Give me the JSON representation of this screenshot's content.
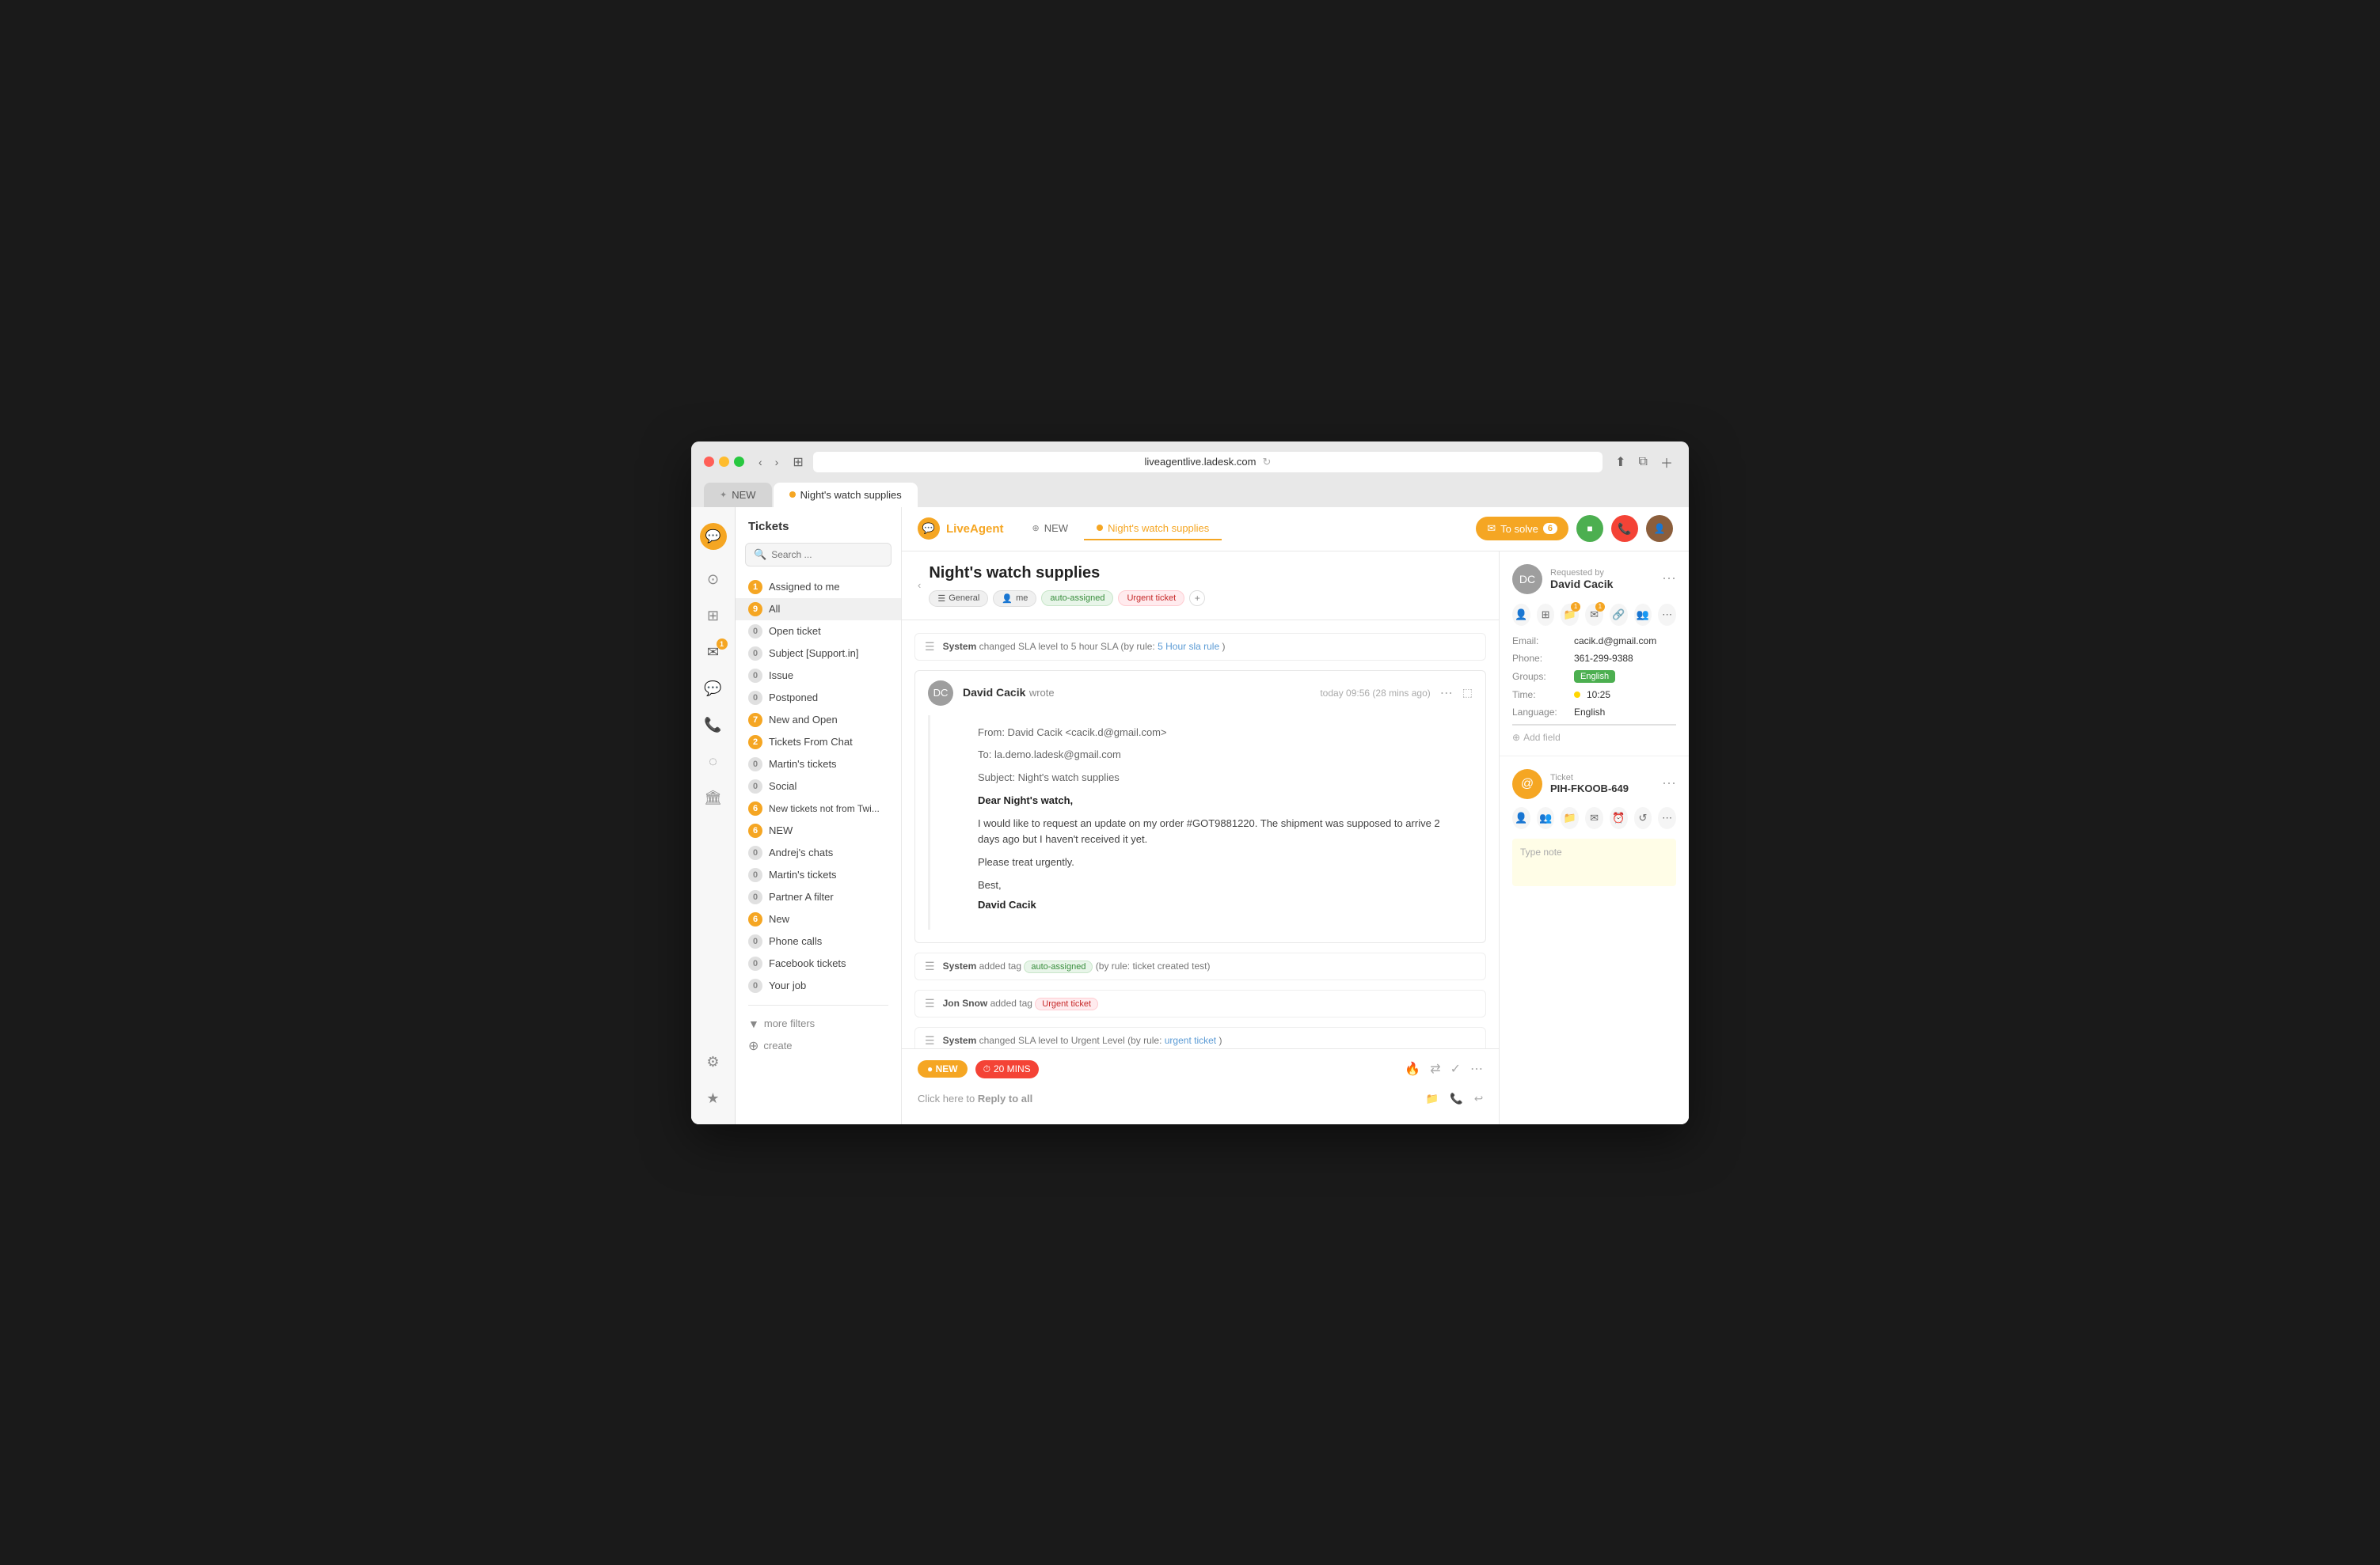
{
  "browser": {
    "url": "liveagentlive.ladesk.com",
    "tabs": [
      {
        "label": "NEW",
        "icon": "✦",
        "active": false
      },
      {
        "label": "Night's watch supplies",
        "dot": true,
        "active": true
      }
    ]
  },
  "header": {
    "logo_text": "LiveAgent",
    "solve_label": "To solve",
    "solve_count": "6",
    "tab_new": "NEW",
    "tab_ticket": "Night's watch supplies"
  },
  "sidebar": {
    "title": "Tickets",
    "search_placeholder": "Search ...",
    "items": [
      {
        "label": "Assigned to me",
        "count": "1",
        "count_type": "orange"
      },
      {
        "label": "All",
        "count": "9",
        "count_type": "orange",
        "active": true
      },
      {
        "label": "Open ticket",
        "count": "0",
        "count_type": "gray"
      },
      {
        "label": "Subject [Support.in]",
        "count": "0",
        "count_type": "gray"
      },
      {
        "label": "Issue",
        "count": "0",
        "count_type": "gray"
      },
      {
        "label": "Postponed",
        "count": "0",
        "count_type": "gray"
      },
      {
        "label": "New and Open",
        "count": "7",
        "count_type": "orange"
      },
      {
        "label": "Tickets From Chat",
        "count": "2",
        "count_type": "orange"
      },
      {
        "label": "Martin's tickets",
        "count": "0",
        "count_type": "gray"
      },
      {
        "label": "Social",
        "count": "0",
        "count_type": "gray"
      },
      {
        "label": "New tickets not from Twi...",
        "count": "6",
        "count_type": "orange"
      },
      {
        "label": "NEW",
        "count": "6",
        "count_type": "orange"
      },
      {
        "label": "Andrej's chats",
        "count": "0",
        "count_type": "gray"
      },
      {
        "label": "Martin's tickets",
        "count": "0",
        "count_type": "gray"
      },
      {
        "label": "Partner A filter",
        "count": "0",
        "count_type": "gray"
      },
      {
        "label": "New",
        "count": "6",
        "count_type": "orange"
      },
      {
        "label": "Phone calls",
        "count": "0",
        "count_type": "gray"
      },
      {
        "label": "Facebook tickets",
        "count": "0",
        "count_type": "gray"
      },
      {
        "label": "Your job",
        "count": "0",
        "count_type": "gray"
      }
    ],
    "more_filters": "more filters",
    "create": "create"
  },
  "ticket": {
    "title": "Night's watch supplies",
    "tags": [
      {
        "label": "General",
        "type": "general",
        "icon": "☰"
      },
      {
        "label": "me",
        "type": "me",
        "icon": "👤"
      },
      {
        "label": "auto-assigned",
        "type": "auto"
      },
      {
        "label": "Urgent ticket",
        "type": "urgent"
      }
    ],
    "system_msg_1": {
      "actor": "System",
      "action": "changed SLA level to 5 hour SLA (by rule:",
      "rule": "5 Hour sla rule",
      "suffix": ")"
    },
    "email": {
      "sender": "David Cacik",
      "wrote": "wrote",
      "time": "today 09:56 (28 mins ago)",
      "from": "From: David Cacik <cacik.d@gmail.com>",
      "to": "To: la.demo.ladesk@gmail.com",
      "subject": "Subject: Night's watch supplies",
      "greeting": "Dear Night's watch,",
      "body1": "I would like to request an update on my order #GOT9881220. The shipment was supposed to arrive 2 days ago but I haven't received it yet.",
      "body2": "Please treat urgently.",
      "closing": "Best,",
      "name": "David Cacik"
    },
    "system_msg_2": {
      "actor": "System",
      "action": "added tag",
      "tag": "auto-assigned",
      "rule": "(by rule: ticket created test)"
    },
    "system_msg_3": {
      "actor": "Jon Snow",
      "action": "added tag",
      "tag": "Urgent ticket"
    },
    "system_msg_4": {
      "actor": "System",
      "action": "changed SLA level to Urgent Level (by rule:",
      "rule": "urgent ticket",
      "suffix": ")"
    },
    "reply": {
      "status": "NEW",
      "timer": "20 MINS",
      "click_text": "Click here to",
      "reply_label": "Reply to all"
    }
  },
  "right_panel": {
    "requested_by": "Requested by",
    "requester_name": "David Cacik",
    "email_label": "Email:",
    "email_value": "cacik.d@gmail.com",
    "phone_label": "Phone:",
    "phone_value": "361-299-9388",
    "groups_label": "Groups:",
    "groups_value": "English",
    "time_label": "Time:",
    "time_value": "10:25",
    "language_label": "Language:",
    "language_value": "English",
    "add_field": "Add field",
    "ticket_label": "Ticket",
    "ticket_id": "PIH-FKOOB-649",
    "note_placeholder": "Type note"
  }
}
